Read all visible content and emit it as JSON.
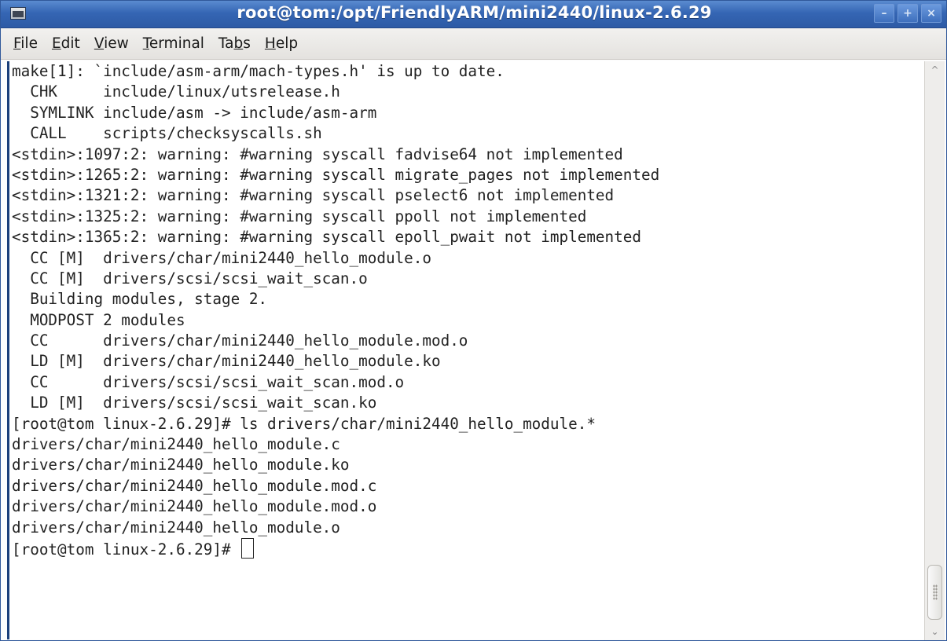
{
  "window": {
    "title": "root@tom:/opt/FriendlyARM/mini2440/linux-2.6.29",
    "buttons": {
      "minimize": "–",
      "maximize": "+",
      "close": "×"
    },
    "icon": "terminal-icon"
  },
  "menu": [
    {
      "pre": "",
      "u": "F",
      "post": "ile"
    },
    {
      "pre": "",
      "u": "E",
      "post": "dit"
    },
    {
      "pre": "",
      "u": "V",
      "post": "iew"
    },
    {
      "pre": "",
      "u": "T",
      "post": "erminal"
    },
    {
      "pre": "Ta",
      "u": "b",
      "post": "s"
    },
    {
      "pre": "",
      "u": "H",
      "post": "elp"
    }
  ],
  "terminal": {
    "lines": [
      "make[1]: `include/asm-arm/mach-types.h' is up to date.",
      "  CHK     include/linux/utsrelease.h",
      "  SYMLINK include/asm -> include/asm-arm",
      "  CALL    scripts/checksyscalls.sh",
      "<stdin>:1097:2: warning: #warning syscall fadvise64 not implemented",
      "<stdin>:1265:2: warning: #warning syscall migrate_pages not implemented",
      "<stdin>:1321:2: warning: #warning syscall pselect6 not implemented",
      "<stdin>:1325:2: warning: #warning syscall ppoll not implemented",
      "<stdin>:1365:2: warning: #warning syscall epoll_pwait not implemented",
      "  CC [M]  drivers/char/mini2440_hello_module.o",
      "  CC [M]  drivers/scsi/scsi_wait_scan.o",
      "  Building modules, stage 2.",
      "  MODPOST 2 modules",
      "  CC      drivers/char/mini2440_hello_module.mod.o",
      "  LD [M]  drivers/char/mini2440_hello_module.ko",
      "  CC      drivers/scsi/scsi_wait_scan.mod.o",
      "  LD [M]  drivers/scsi/scsi_wait_scan.ko",
      "[root@tom linux-2.6.29]# ls drivers/char/mini2440_hello_module.*",
      "drivers/char/mini2440_hello_module.c",
      "drivers/char/mini2440_hello_module.ko",
      "drivers/char/mini2440_hello_module.mod.c",
      "drivers/char/mini2440_hello_module.mod.o",
      "drivers/char/mini2440_hello_module.o"
    ],
    "prompt": "[root@tom linux-2.6.29]# "
  },
  "colors": {
    "titlebar": "#3566b4",
    "terminal_bg": "#ffffff",
    "terminal_fg": "#222222"
  }
}
